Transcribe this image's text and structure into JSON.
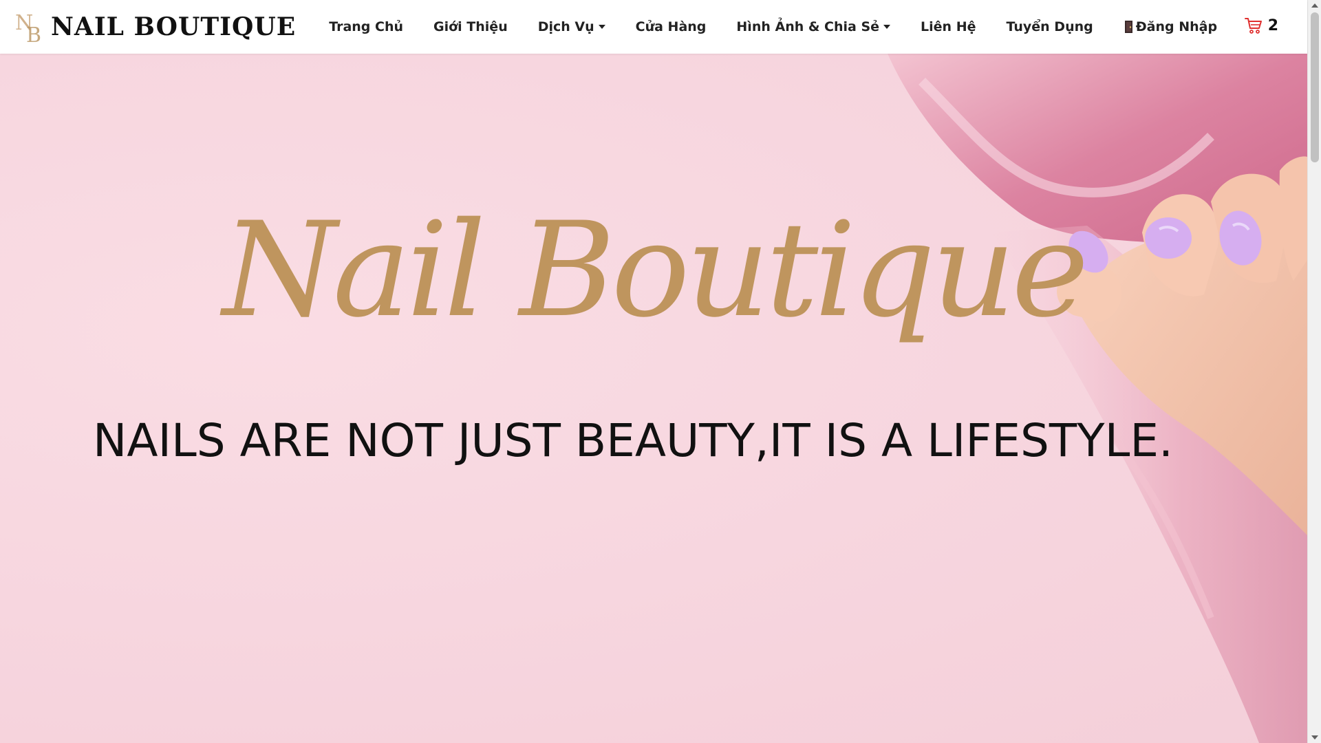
{
  "brand": {
    "monogram": "NB",
    "name": "NAIL BOUTIQUE"
  },
  "nav": {
    "items": [
      {
        "label": "Trang Chủ",
        "dropdown": false
      },
      {
        "label": "Giới Thiệu",
        "dropdown": false
      },
      {
        "label": "Dịch Vụ",
        "dropdown": true
      },
      {
        "label": "Cửa Hàng",
        "dropdown": false
      },
      {
        "label": "Hình Ảnh & Chia Sẻ",
        "dropdown": true
      },
      {
        "label": "Liên Hệ",
        "dropdown": false
      },
      {
        "label": "Tuyển Dụng",
        "dropdown": false
      }
    ],
    "login_label": "Đăng Nhập",
    "login_icon": "door-icon"
  },
  "cart": {
    "count": "2",
    "icon": "cart-icon",
    "color": "#e0302f"
  },
  "hero": {
    "script_title": "Nail Boutique",
    "tagline": "NAILS ARE NOT JUST BEAUTY,IT IS A LIFESTYLE.",
    "script_color": "#bf955e",
    "background_color": "#f7d8e0",
    "nail_polish_color": "#d6aef0"
  }
}
